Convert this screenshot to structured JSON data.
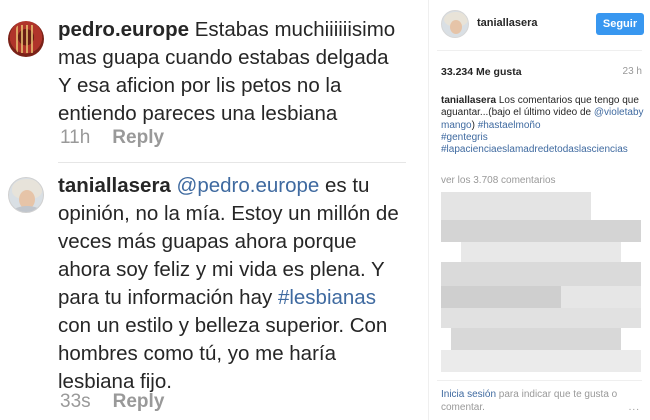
{
  "thread": {
    "comment1": {
      "username": "pedro.europe",
      "text_part1": " Estabas muchiiiiiisimo",
      "text_line2": "mas guapa cuando estabas delgada",
      "text_line3": "Y esa aficion por lis petos no la",
      "text_line4": "entiendo pareces una lesbiana",
      "time": "11h",
      "reply_label": "Reply"
    },
    "comment2": {
      "username": "taniallasera",
      "mention": "@pedro.europe",
      "line1_tail": " es tu",
      "line2": "opinión, no la mía. Estoy un millón de",
      "line3": "veces más guapas ahora porque",
      "line4": "ahora soy feliz y mi vida es plena. Y",
      "line5_head": "para tu información hay ",
      "hashtag": "#lesbianas",
      "line6": "con un estilo y belleza superior. Con",
      "line7": "hombres como tú, yo me haría",
      "line8": "lesbiana fijo.",
      "time": "33s",
      "reply_label": "Reply"
    }
  },
  "panel": {
    "username": "taniallasera",
    "follow_label": "Seguir",
    "likes": "33.234 Me gusta",
    "time": "23 h",
    "caption_user": "taniallasera",
    "caption_text": " Los comentarios que tengo que aguantar...(bajo el último video de ",
    "caption_mention": "@violetabymango",
    "caption_tag1": "#hastaelmoño",
    "caption_tag2": "#gentegris",
    "caption_tag3": "#lapacienciaeslamadredetodaslasciencias",
    "view_all": "ver los 3.708 comentarios",
    "login_link": "Inicia sesión",
    "login_text": " para indicar que te gusta o comentar.",
    "more_dots": "..."
  },
  "colors": {
    "link": "#3f6aa0",
    "follow_button": "#3897f0",
    "muted": "#999999"
  }
}
